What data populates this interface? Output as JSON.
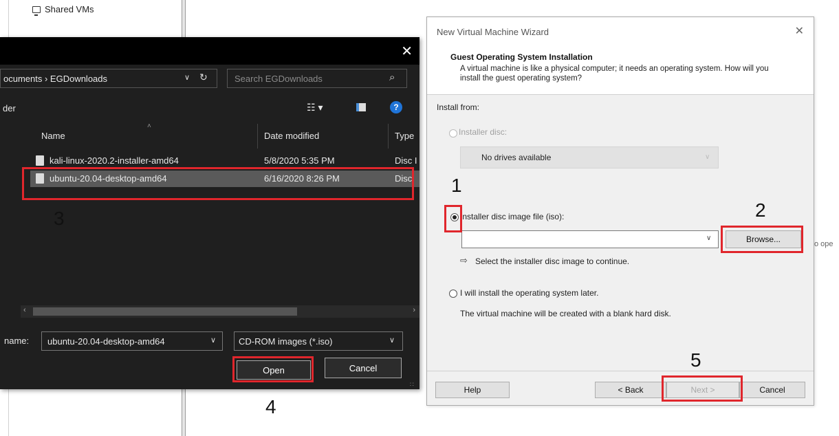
{
  "background_app": {
    "shared_vms_label": "Shared VMs",
    "side_text": "o ope"
  },
  "file_dialog": {
    "close_glyph": "✕",
    "path": "ocuments  ›  EGDownloads",
    "search_placeholder": "Search EGDownloads",
    "folder_label": "der",
    "columns": {
      "name": "Name",
      "date": "Date modified",
      "type": "Type"
    },
    "files": [
      {
        "name": "kali-linux-2020.2-installer-amd64",
        "date": "5/8/2020 5:35 PM",
        "type": "Disc I"
      },
      {
        "name": "ubuntu-20.04-desktop-amd64",
        "date": "6/16/2020 8:26 PM",
        "type": "Disc"
      }
    ],
    "filename_label": "name:",
    "filename_value": "ubuntu-20.04-desktop-amd64",
    "filetype_value": "CD-ROM images (*.iso)",
    "open_label": "Open",
    "cancel_label": "Cancel"
  },
  "wizard": {
    "title": "New Virtual Machine Wizard",
    "close_glyph": "✕",
    "heading": "Guest Operating System Installation",
    "description": "A virtual machine is like a physical computer; it needs an operating system. How will you install the guest operating system?",
    "install_from": "Install from:",
    "option_disc": "Installer disc:",
    "drives_value": "No drives available",
    "option_iso": "Installer disc image file (iso):",
    "iso_value": "",
    "browse_label": "Browse...",
    "hint": "Select the installer disc image to continue.",
    "option_later": "I will install the operating system later.",
    "later_desc": "The virtual machine will be created with a blank hard disk.",
    "help_label": "Help",
    "back_label": "< Back",
    "next_label": "Next >",
    "cancel_label": "Cancel"
  },
  "annotations": {
    "step1": "1",
    "step2": "2",
    "step3": "3",
    "step4": "4",
    "step5": "5",
    "highlight_color": "#e0262c"
  }
}
